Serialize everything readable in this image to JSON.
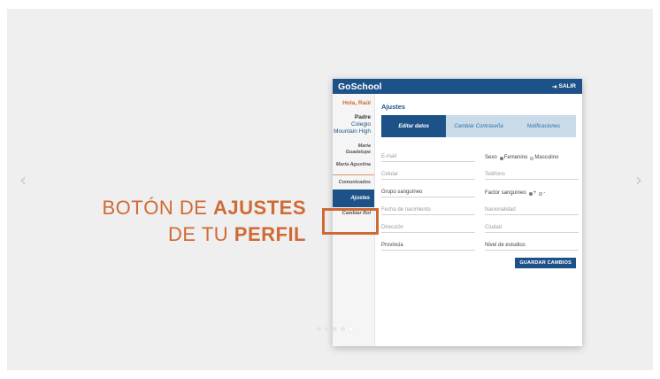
{
  "nav": {
    "prev_glyph": "‹",
    "next_glyph": "›"
  },
  "caption": {
    "line1_pre": "BOTÓN DE ",
    "line1_bold": "AJUSTES",
    "line2_pre": "DE TU ",
    "line2_bold": "PERFIL"
  },
  "app": {
    "brand": "GoSchool",
    "logout_icon": "⇥",
    "logout_label": "SALIR"
  },
  "sidebar": {
    "greeting": "Hola, Raúl",
    "role": "Padre",
    "school": "Colegio Mountain High",
    "children": [
      "María Guadalupe",
      "María Agustina"
    ],
    "comunicados": "Comunicados",
    "ajustes": "Ajustes",
    "cambiar_rol": "Cambiar Rol"
  },
  "main": {
    "title": "Ajustes",
    "tabs": [
      "Editar datos",
      "Cambiar Contraseña",
      "Notificaciones"
    ],
    "fields": {
      "email": "E-mail",
      "celular": "Celular",
      "grupo": "Grupo sanguíneo",
      "fecha": "Fecha de nacimiento",
      "direccion": "Dirección",
      "provincia": "Provincia",
      "sexo_label": "Sexo",
      "sexo_f": "Femenino",
      "sexo_m": "Masculino",
      "telefono": "Teléfono",
      "factor_label": "Factor sanguíneo",
      "factor_plus": "+",
      "factor_minus": "-",
      "nacionalidad": "Nacionalidad",
      "ciudad": "Ciudad",
      "estudios": "Nivel de estudios"
    },
    "save_label": "GUARDAR CAMBIOS"
  },
  "carousel": {
    "active_index": 4,
    "count": 5
  }
}
